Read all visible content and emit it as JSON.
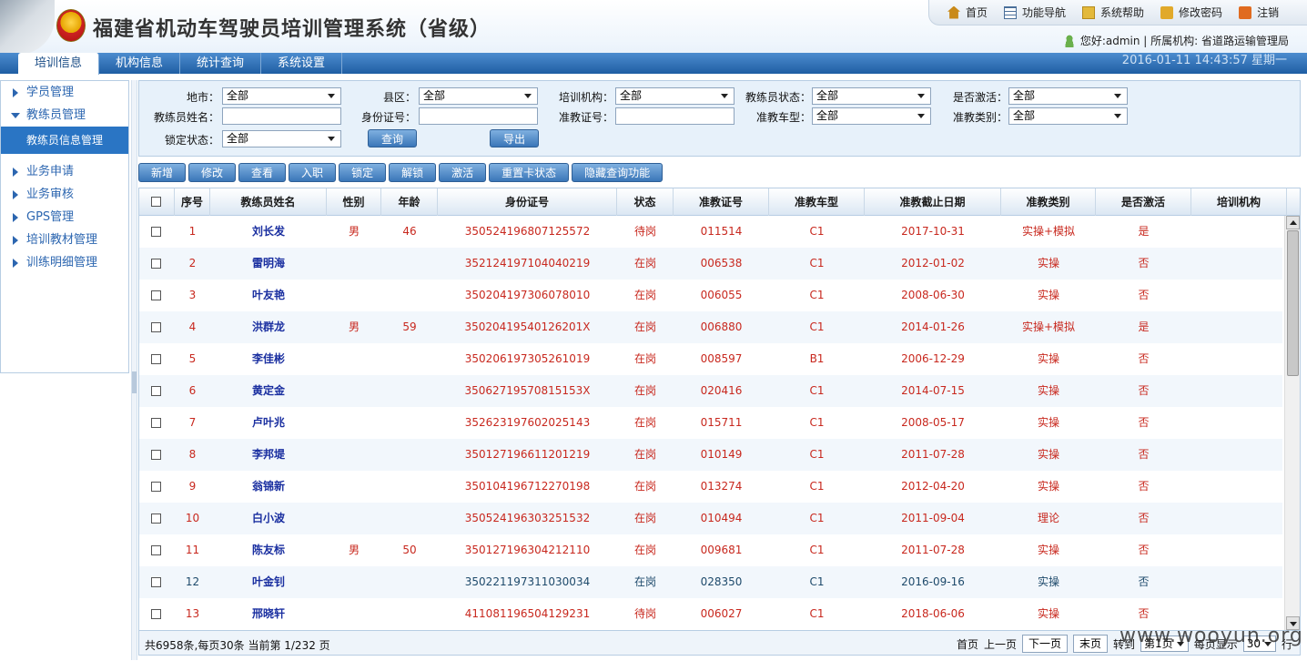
{
  "header": {
    "title": "福建省机动车驾驶员培训管理系统（省级）",
    "nav": [
      {
        "label": "首页",
        "icon": "home-icon"
      },
      {
        "label": "功能导航",
        "icon": "grid-icon"
      },
      {
        "label": "系统帮助",
        "icon": "help-book-icon"
      },
      {
        "label": "修改密码",
        "icon": "lock-icon"
      },
      {
        "label": "注销",
        "icon": "logout-icon"
      }
    ],
    "user_greeting": "您好:admin | 所属机构: 省道路运输管理局",
    "datetime": "2016-01-11 14:43:57 星期一"
  },
  "tabs": [
    {
      "label": "培训信息",
      "active": true
    },
    {
      "label": "机构信息"
    },
    {
      "label": "统计查询"
    },
    {
      "label": "系统设置"
    }
  ],
  "sidebar": {
    "items": [
      {
        "label": "学员管理"
      },
      {
        "label": "教练员管理",
        "open": true
      },
      {
        "label": "业务申请"
      },
      {
        "label": "业务审核"
      },
      {
        "label": "GPS管理"
      },
      {
        "label": "培训教材管理"
      },
      {
        "label": "训练明细管理"
      }
    ],
    "sub_item": "教练员信息管理"
  },
  "filter": {
    "city_label": "地市：",
    "city_value": "全部",
    "district_label": "县区：",
    "district_value": "全部",
    "org_label": "培训机构：",
    "org_value": "全部",
    "coach_status_label": "教练员状态：",
    "coach_status_value": "全部",
    "activated_label": "是否激活：",
    "activated_value": "全部",
    "name_label": "教练员姓名：",
    "name_value": "",
    "idcard_label": "身份证号：",
    "idcard_value": "",
    "cert_label": "准教证号：",
    "cert_value": "",
    "vehicle_label": "准教车型：",
    "vehicle_value": "全部",
    "category_label": "准教类别：",
    "category_value": "全部",
    "lock_label": "锁定状态：",
    "lock_value": "全部",
    "query_button": "查询",
    "export_button": "导出"
  },
  "toolbar": [
    "新增",
    "修改",
    "查看",
    "入职",
    "锁定",
    "解锁",
    "激活",
    "重置卡状态",
    "隐藏查询功能"
  ],
  "grid": {
    "columns": [
      "序号",
      "教练员姓名",
      "性别",
      "年龄",
      "身份证号",
      "状态",
      "准教证号",
      "准教车型",
      "准教截止日期",
      "准教类别",
      "是否激活",
      "培训机构"
    ],
    "rows": [
      {
        "no": "1",
        "name": "刘长发",
        "gender": "男",
        "age": "46",
        "idcard": "350524196807125572",
        "status": "待岗",
        "cert": "011514",
        "vehicle": "C1",
        "expiry": "2017-10-31",
        "category": "实操+模拟",
        "active": "是",
        "org": ""
      },
      {
        "no": "2",
        "name": "雷明海",
        "gender": "",
        "age": "",
        "idcard": "352124197104040219",
        "status": "在岗",
        "cert": "006538",
        "vehicle": "C1",
        "expiry": "2012-01-02",
        "category": "实操",
        "active": "否",
        "org": ""
      },
      {
        "no": "3",
        "name": "叶友艳",
        "gender": "",
        "age": "",
        "idcard": "350204197306078010",
        "status": "在岗",
        "cert": "006055",
        "vehicle": "C1",
        "expiry": "2008-06-30",
        "category": "实操",
        "active": "否",
        "org": ""
      },
      {
        "no": "4",
        "name": "洪群龙",
        "gender": "男",
        "age": "59",
        "idcard": "35020419540126201X",
        "status": "在岗",
        "cert": "006880",
        "vehicle": "C1",
        "expiry": "2014-01-26",
        "category": "实操+模拟",
        "active": "是",
        "org": ""
      },
      {
        "no": "5",
        "name": "李佳彬",
        "gender": "",
        "age": "",
        "idcard": "350206197305261019",
        "status": "在岗",
        "cert": "008597",
        "vehicle": "B1",
        "expiry": "2006-12-29",
        "category": "实操",
        "active": "否",
        "org": ""
      },
      {
        "no": "6",
        "name": "黄定金",
        "gender": "",
        "age": "",
        "idcard": "35062719570815153X",
        "status": "在岗",
        "cert": "020416",
        "vehicle": "C1",
        "expiry": "2014-07-15",
        "category": "实操",
        "active": "否",
        "org": ""
      },
      {
        "no": "7",
        "name": "卢叶兆",
        "gender": "",
        "age": "",
        "idcard": "352623197602025143",
        "status": "在岗",
        "cert": "015711",
        "vehicle": "C1",
        "expiry": "2008-05-17",
        "category": "实操",
        "active": "否",
        "org": ""
      },
      {
        "no": "8",
        "name": "李邦堤",
        "gender": "",
        "age": "",
        "idcard": "350127196611201219",
        "status": "在岗",
        "cert": "010149",
        "vehicle": "C1",
        "expiry": "2011-07-28",
        "category": "实操",
        "active": "否",
        "org": ""
      },
      {
        "no": "9",
        "name": "翁锦新",
        "gender": "",
        "age": "",
        "idcard": "350104196712270198",
        "status": "在岗",
        "cert": "013274",
        "vehicle": "C1",
        "expiry": "2012-04-20",
        "category": "实操",
        "active": "否",
        "org": ""
      },
      {
        "no": "10",
        "name": "白小波",
        "gender": "",
        "age": "",
        "idcard": "350524196303251532",
        "status": "在岗",
        "cert": "010494",
        "vehicle": "C1",
        "expiry": "2011-09-04",
        "category": "理论",
        "active": "否",
        "org": ""
      },
      {
        "no": "11",
        "name": "陈友标",
        "gender": "男",
        "age": "50",
        "idcard": "350127196304212110",
        "status": "在岗",
        "cert": "009681",
        "vehicle": "C1",
        "expiry": "2011-07-28",
        "category": "实操",
        "active": "否",
        "org": ""
      },
      {
        "no": "12",
        "name": "叶金钊",
        "gender": "",
        "age": "",
        "idcard": "350221197311030034",
        "status": "在岗",
        "cert": "028350",
        "vehicle": "C1",
        "expiry": "2016-09-16",
        "category": "实操",
        "active": "否",
        "org": "",
        "valid": true
      },
      {
        "no": "13",
        "name": "邢晓轩",
        "gender": "",
        "age": "",
        "idcard": "411081196504129231",
        "status": "待岗",
        "cert": "006027",
        "vehicle": "C1",
        "expiry": "2018-06-06",
        "category": "实操",
        "active": "否",
        "org": ""
      }
    ]
  },
  "pager": {
    "info": "共6958条,每页30条 当前第 1/232 页",
    "first": "首页",
    "prev": "上一页",
    "next": "下一页",
    "last": "末页",
    "goto_label": "转到",
    "goto_value": "第1页",
    "page_size_label": "每页显示",
    "page_size_value": "30",
    "page_size_suffix": "行"
  },
  "watermark": "www.wooyun.org",
  "colors": {
    "accent": "#2a75c4",
    "text_red": "#c8281e",
    "name_blue": "#1a2fa0"
  }
}
